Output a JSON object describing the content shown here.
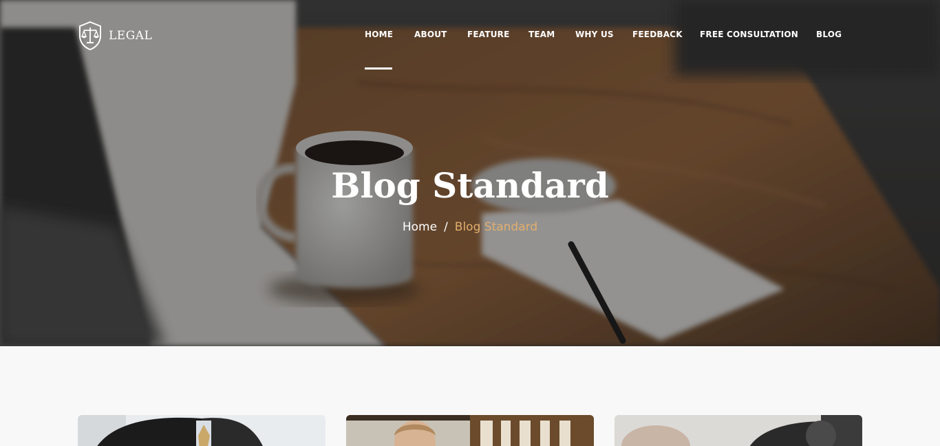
{
  "header": {
    "logo_text": "LEGAL",
    "logo_icon": "scales-shield-icon",
    "nav": [
      {
        "label": "HOME",
        "active": true
      },
      {
        "label": "ABOUT"
      },
      {
        "label": "FEATURE"
      },
      {
        "label": "TEAM"
      },
      {
        "label": "WHY US"
      },
      {
        "label": "FEEDBACK"
      },
      {
        "label": "FREE CONSULTATION"
      },
      {
        "label": "BLOG"
      }
    ]
  },
  "hero": {
    "title": "Blog Standard",
    "breadcrumb": {
      "home": "Home",
      "separator": "/",
      "current": "Blog Standard"
    }
  },
  "colors": {
    "accent": "#e2ae6d",
    "page_background": "#f8f8f8"
  }
}
